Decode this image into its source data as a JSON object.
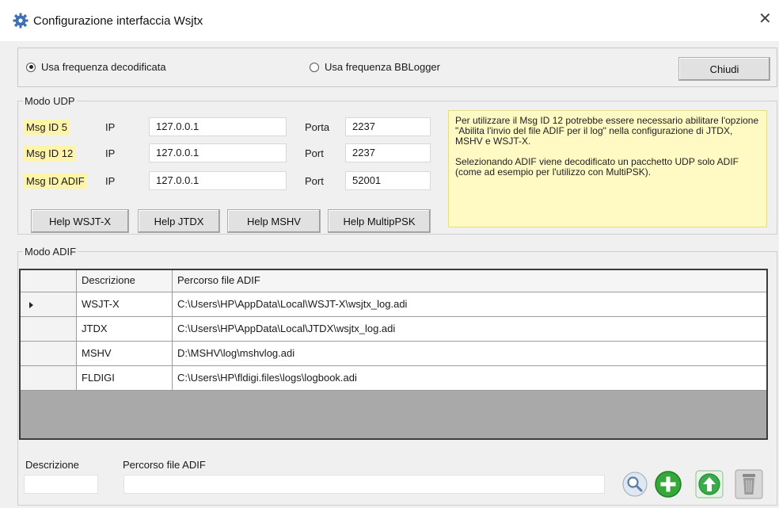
{
  "window": {
    "title": "Configurazione interfaccia Wsjtx"
  },
  "top": {
    "radio_decoded": "Usa frequenza decodificata",
    "radio_bblogger": "Usa frequenza BBLogger",
    "close_button": "Chiudi",
    "selected": "decoded"
  },
  "udp": {
    "legend": "Modo UDP",
    "rows": [
      {
        "name": "Msg ID 5",
        "ip_label": "IP",
        "ip": "127.0.0.1",
        "port_label": "Porta",
        "port": "2237"
      },
      {
        "name": "Msg ID 12",
        "ip_label": "IP",
        "ip": "127.0.0.1",
        "port_label": "Port",
        "port": "2237"
      },
      {
        "name": "Msg ID ADIF",
        "ip_label": "IP",
        "ip": "127.0.0.1",
        "port_label": "Port",
        "port": "52001"
      }
    ],
    "help_buttons": [
      "Help WSJT-X",
      "Help JTDX",
      "Help MSHV",
      "Help MultipPSK"
    ],
    "info_p1": "Per utilizzare il Msg ID 12 potrebbe essere necessario abilitare l'opzione \"Abilita l'invio del file ADIF per il log\" nella configurazione di JTDX, MSHV e WSJT-X.",
    "info_p2": "Selezionando ADIF viene decodificato un pacchetto UDP solo ADIF (come ad esempio per l'utilizzo con MultiPSK)."
  },
  "adif": {
    "legend": "Modo ADIF",
    "columns": [
      "Descrizione",
      "Percorso file ADIF"
    ],
    "rows": [
      {
        "desc": "WSJT-X",
        "path": "C:\\Users\\HP\\AppData\\Local\\WSJT-X\\wsjtx_log.adi",
        "current": true
      },
      {
        "desc": "JTDX",
        "path": "C:\\Users\\HP\\AppData\\Local\\JTDX\\wsjtx_log.adi",
        "current": false
      },
      {
        "desc": "MSHV",
        "path": "D:\\MSHV\\log\\mshvlog.adi",
        "current": false
      },
      {
        "desc": "FLDIGI",
        "path": "C:\\Users\\HP\\fldigi.files\\logs\\logbook.adi",
        "current": false
      }
    ]
  },
  "bottom": {
    "desc_label": "Descrizione",
    "path_label": "Percorso file ADIF",
    "desc_value": "",
    "path_value": ""
  },
  "icons": {
    "app": "gear-icon",
    "close": "close-icon",
    "browse": "search-icon",
    "add": "plus-icon",
    "save": "arrow-up-icon",
    "delete": "trash-icon"
  },
  "colors": {
    "highlight": "#fff4a8",
    "info_bg": "#fff9c4",
    "add_green": "#35a83a",
    "grid_empty": "#a9a9a9"
  }
}
